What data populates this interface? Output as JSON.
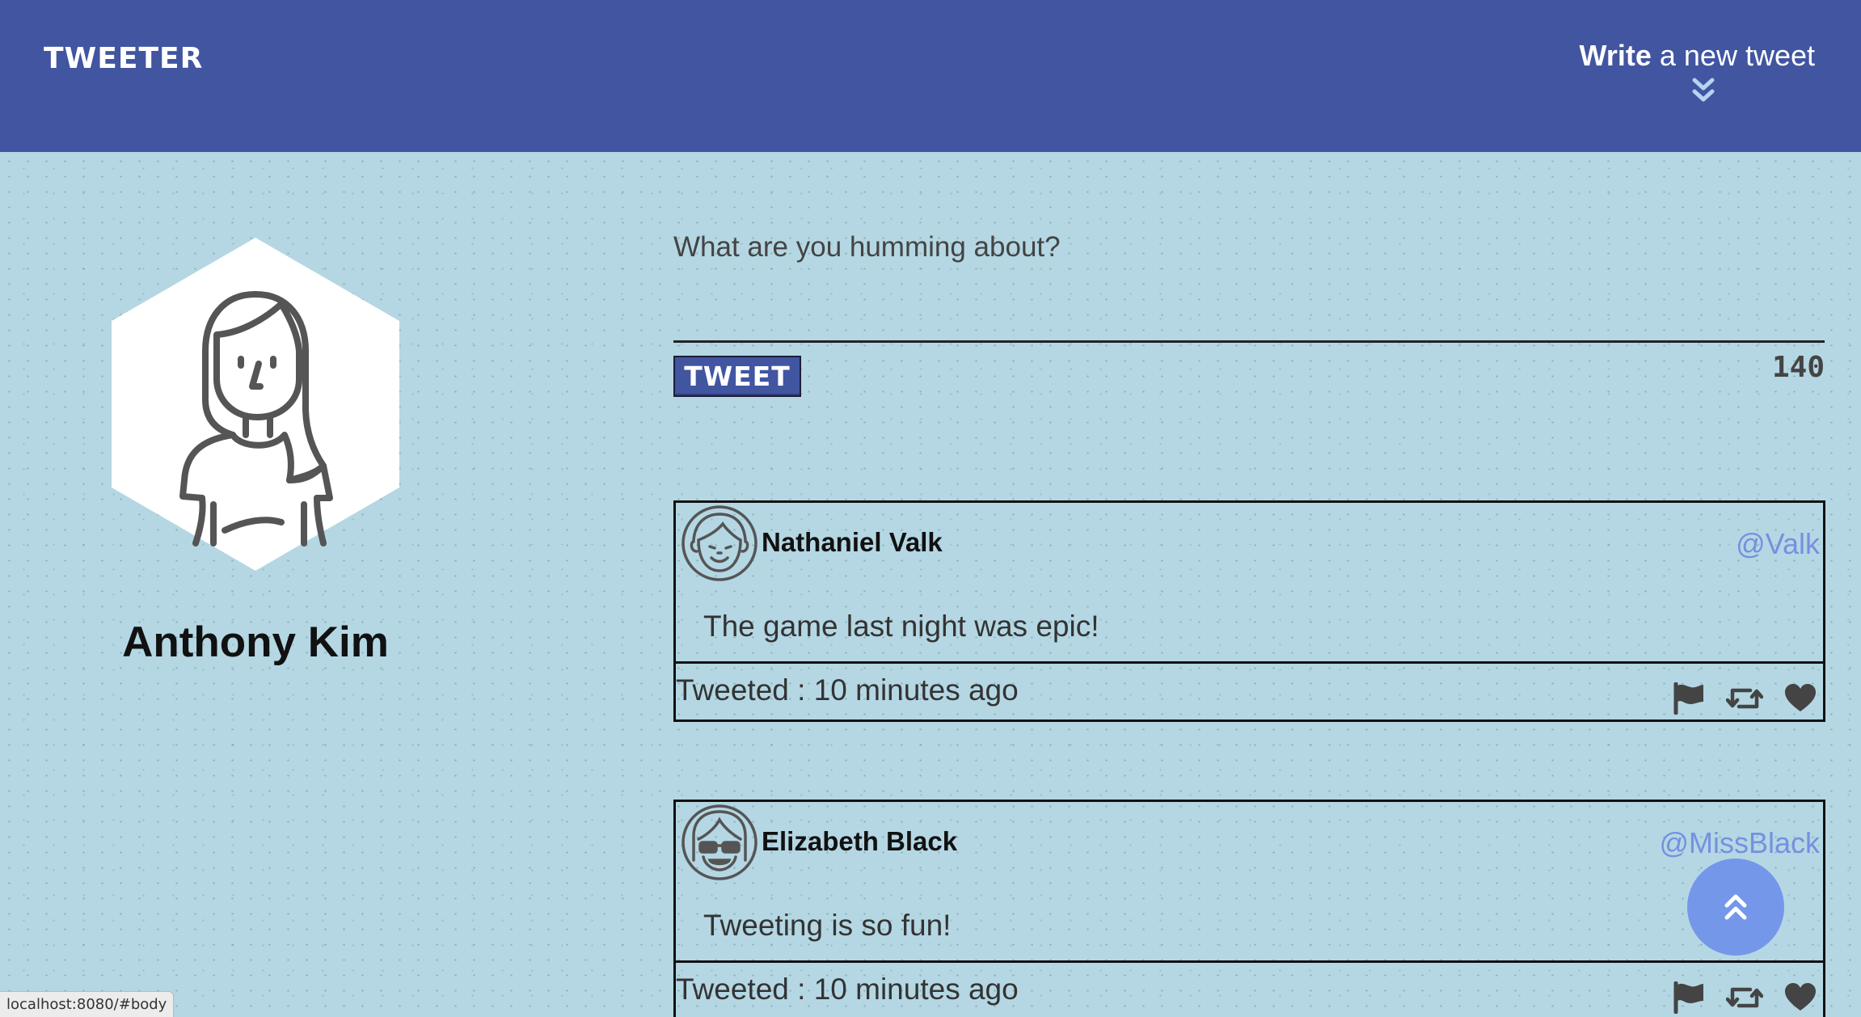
{
  "nav": {
    "brand": "TWEETER",
    "compose_bold": "Write",
    "compose_rest": "a new tweet"
  },
  "profile": {
    "name": "Anthony Kim"
  },
  "compose": {
    "placeholder": "What are you humming about?",
    "button_label": "TWEET",
    "counter": "140"
  },
  "tweets": [
    {
      "author": "Nathaniel Valk",
      "handle": "@Valk",
      "body": "The game last night was epic!",
      "time": "Tweeted : 10 minutes ago"
    },
    {
      "author": "Elizabeth Black",
      "handle": "@MissBlack",
      "body": "Tweeting is so fun!",
      "time": "Tweeted : 10 minutes ago"
    }
  ],
  "status_bar": {
    "url": "localhost:8080/#body"
  },
  "colors": {
    "nav": "#4155a0",
    "background": "#b4d7e3",
    "handle": "#7690e0",
    "fab": "#7597e9"
  },
  "icons": {
    "compose_toggle": "double-chevron-down-icon",
    "flag": "flag-icon",
    "retweet": "retweet-icon",
    "like": "heart-icon",
    "scroll_top": "double-chevron-up-icon"
  }
}
